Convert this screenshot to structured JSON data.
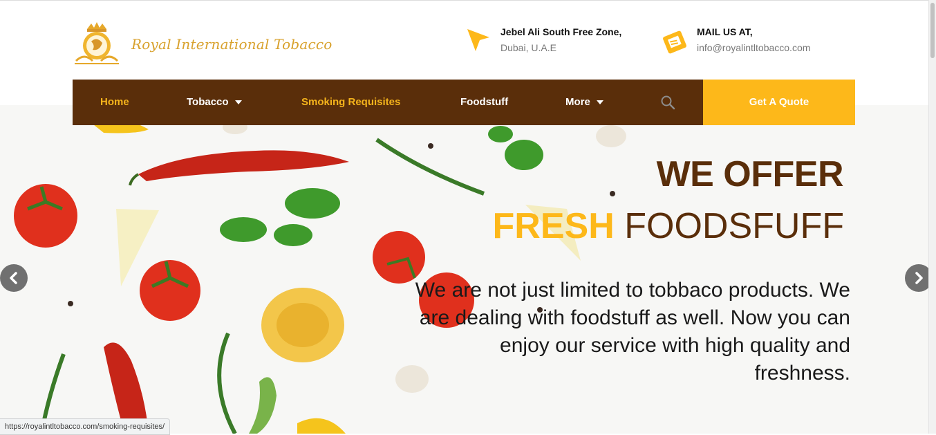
{
  "brand": {
    "name": "Royal International Tobacco"
  },
  "contacts": {
    "location": {
      "title": "Jebel Ali South Free Zone,",
      "subtitle": "Dubai, U.A.E",
      "icon": "location-arrow-icon"
    },
    "mail": {
      "title": "MAIL US AT,",
      "subtitle": "info@royalintltobacco.com",
      "icon": "mail-icon"
    }
  },
  "nav": {
    "items": [
      {
        "label": "Home",
        "active": true
      },
      {
        "label": "Tobacco",
        "dropdown": true
      },
      {
        "label": "Smoking Requisites",
        "active": true
      },
      {
        "label": "Foodstuff"
      },
      {
        "label": "More",
        "dropdown": true
      }
    ],
    "search_icon": "search-icon",
    "quote_label": "Get A Quote"
  },
  "hero": {
    "line1": "WE OFFER",
    "line2_highlight": "FRESH",
    "line2_rest": "FOODSFUFF",
    "paragraph": "We are not just limited to tobbaco products. We are dealing with foodstuff as well. Now you can enjoy our service with high quality and freshness."
  },
  "status_bar": {
    "url": "https://royalintltobacco.com/smoking-requisites/"
  },
  "colors": {
    "brown": "#5a2e0a",
    "accent": "#fdb81a",
    "gold": "#d8a12c"
  }
}
